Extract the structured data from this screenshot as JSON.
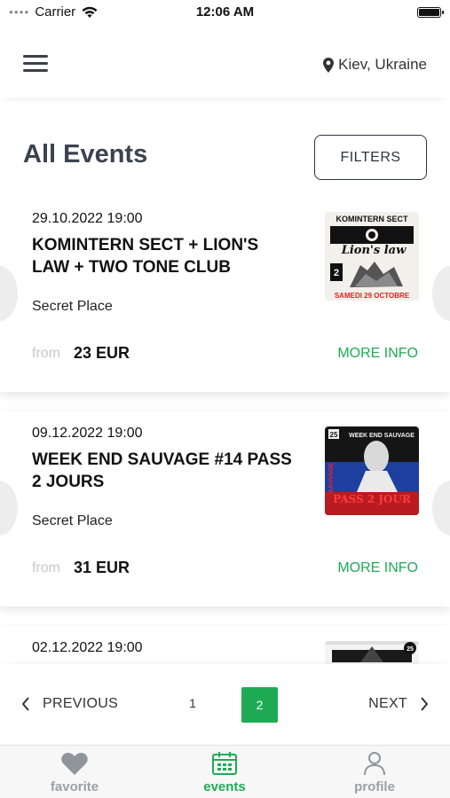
{
  "status_bar": {
    "carrier": "Carrier",
    "time": "12:06 AM"
  },
  "header": {
    "location": "Kiev, Ukraine"
  },
  "main": {
    "title": "All Events",
    "filters_label": "FILTERS"
  },
  "events": [
    {
      "date": "29.10.2022 19:00",
      "title": "KOMINTERN SECT + LION'S LAW + TWO TONE CLUB",
      "venue": "Secret Place",
      "from_label": "from",
      "price": "23 EUR",
      "more_info": "MORE INFO",
      "poster": {
        "top_text": "KOMINTERN SECT",
        "band": "Lion's law",
        "bottom_text": "SAMEDI 29 OCTOBRE"
      }
    },
    {
      "date": "09.12.2022 19:00",
      "title": "WEEK END SAUVAGE #14 PASS 2 JOURS",
      "venue": "Secret Place",
      "from_label": "from",
      "price": "31 EUR",
      "more_info": "MORE INFO",
      "poster": {
        "top_text": "WEEK END SAUVAGE",
        "side_text": "SAUVAGE",
        "bottom_text": "PASS 2 JOUR",
        "badge": "25"
      }
    },
    {
      "date": "02.12.2022 19:00",
      "title": "",
      "venue": "",
      "from_label": "",
      "price": "",
      "more_info": "",
      "poster": {
        "badge": "25"
      }
    }
  ],
  "pagination": {
    "previous_label": "PREVIOUS",
    "next_label": "NEXT",
    "pages": [
      "1",
      "2"
    ],
    "current_page": "2"
  },
  "tab_bar": {
    "tabs": [
      {
        "label": "favorite",
        "icon": "heart-icon",
        "active": false
      },
      {
        "label": "events",
        "icon": "calendar-icon",
        "active": true
      },
      {
        "label": "profile",
        "icon": "person-icon",
        "active": false
      }
    ]
  },
  "colors": {
    "accent": "#1fab54",
    "title": "#3b4350",
    "inactive_tab": "#9aa0a6"
  }
}
